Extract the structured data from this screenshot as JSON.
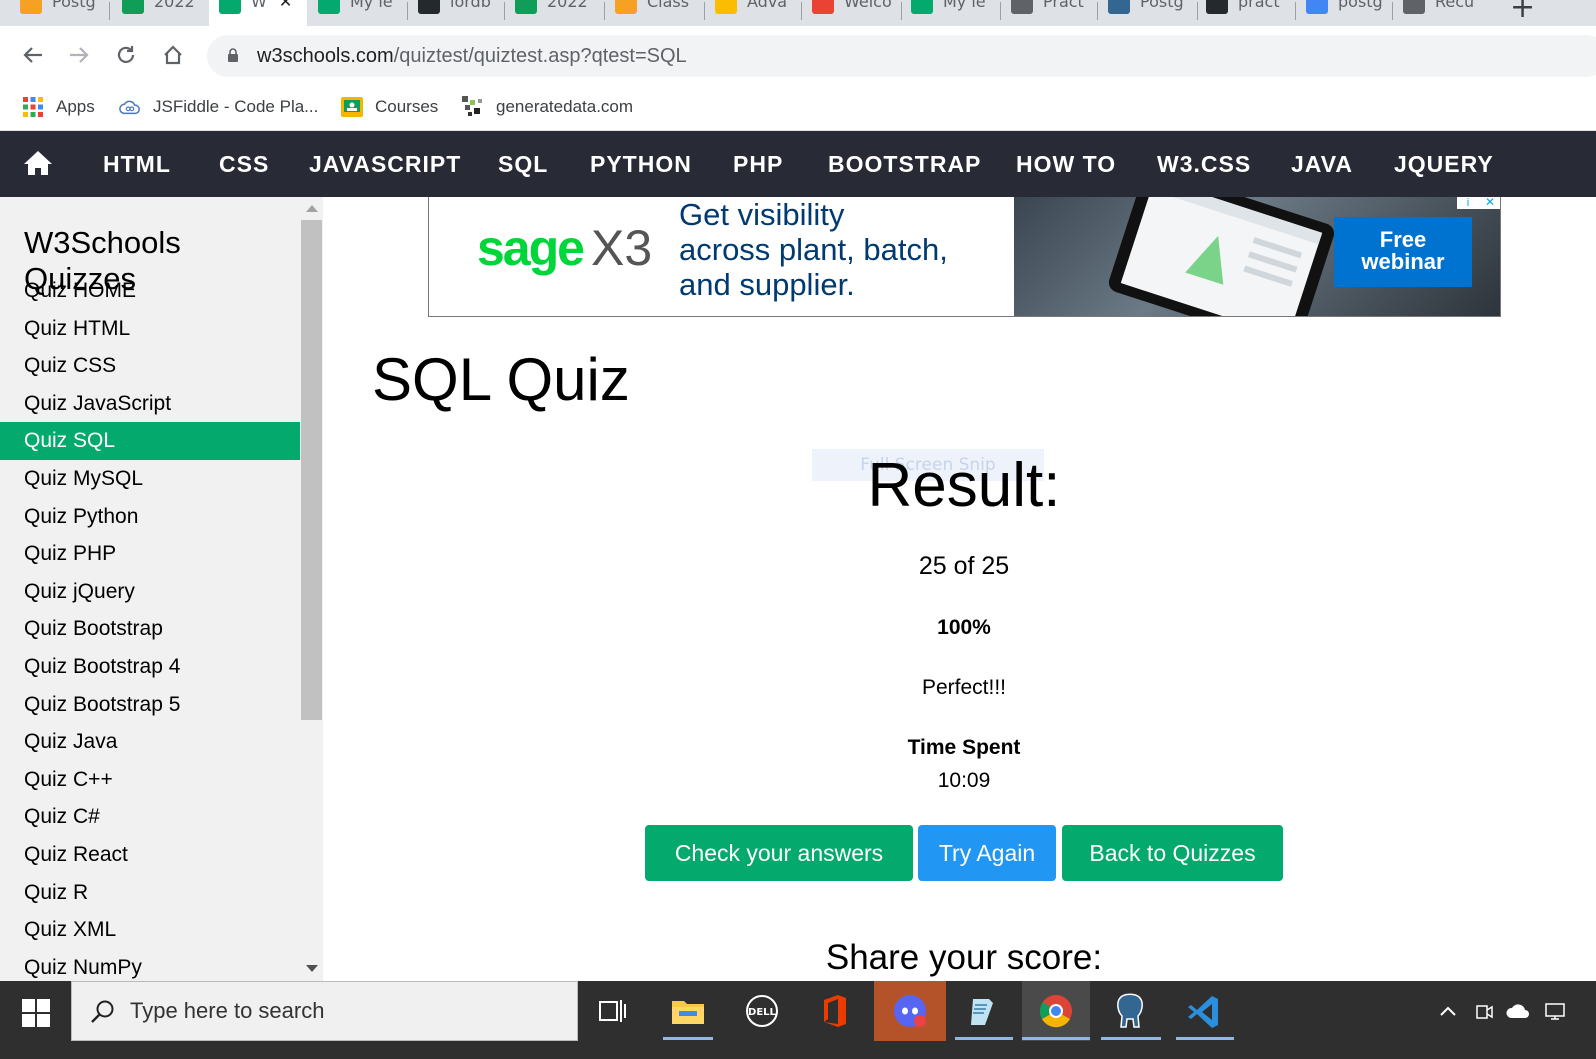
{
  "browser": {
    "tabs": [
      {
        "label": "Postg",
        "icon": "postgres-classroom-icon",
        "color": "#f4a124"
      },
      {
        "label": "2022",
        "icon": "sheets-icon",
        "color": "#0f9d58"
      },
      {
        "label": "W",
        "icon": "w3schools-icon",
        "color": "#04aa6d",
        "active": true,
        "close": "✕"
      },
      {
        "label": "My le",
        "icon": "w3schools-icon",
        "color": "#04aa6d"
      },
      {
        "label": "lordb",
        "icon": "github-icon",
        "color": "#24292e"
      },
      {
        "label": "2022",
        "icon": "sheets-icon",
        "color": "#0f9d58"
      },
      {
        "label": "Class",
        "icon": "classroom-icon",
        "color": "#f4a124"
      },
      {
        "label": "Adva",
        "icon": "drive-icon",
        "color": "#fbbc04"
      },
      {
        "label": "Welco",
        "icon": "gmail-icon",
        "color": "#ea4335"
      },
      {
        "label": "My le",
        "icon": "w3schools-icon",
        "color": "#04aa6d"
      },
      {
        "label": "Pract",
        "icon": "globe-icon",
        "color": "#5f6368"
      },
      {
        "label": "Postg",
        "icon": "postgres-icon",
        "color": "#336791"
      },
      {
        "label": "pract",
        "icon": "github-icon",
        "color": "#24292e"
      },
      {
        "label": "postg",
        "icon": "google-icon",
        "color": "#4285f4"
      },
      {
        "label": "Recu",
        "icon": "globe-icon",
        "color": "#5f6368"
      }
    ],
    "new_tab": "+",
    "url_host": "w3schools.com",
    "url_path": "/quiztest/quiztest.asp?qtest=SQL",
    "bookmarks": [
      {
        "label": "Apps",
        "icon": "apps-grid-icon"
      },
      {
        "label": "JSFiddle - Code Pla...",
        "icon": "jsfiddle-cloud-icon"
      },
      {
        "label": "Courses",
        "icon": "classroom-icon"
      },
      {
        "label": "generatedata.com",
        "icon": "generatedata-icon"
      }
    ]
  },
  "topnav": {
    "items": [
      "HTML",
      "CSS",
      "JAVASCRIPT",
      "SQL",
      "PYTHON",
      "PHP",
      "BOOTSTRAP",
      "HOW TO",
      "W3.CSS",
      "JAVA",
      "JQUERY"
    ]
  },
  "sidebar": {
    "title": "W3Schools Quizzes",
    "items": [
      "Quiz HOME",
      "Quiz HTML",
      "Quiz CSS",
      "Quiz JavaScript",
      "Quiz SQL",
      "Quiz MySQL",
      "Quiz Python",
      "Quiz PHP",
      "Quiz jQuery",
      "Quiz Bootstrap",
      "Quiz Bootstrap 4",
      "Quiz Bootstrap 5",
      "Quiz Java",
      "Quiz C++",
      "Quiz C#",
      "Quiz React",
      "Quiz R",
      "Quiz XML",
      "Quiz NumPy"
    ],
    "active_index": 4
  },
  "ad": {
    "brand": "sage",
    "model": "X3",
    "line1": "Get visibility",
    "line2": "across plant, batch,",
    "line3": "and supplier.",
    "cta_line1": "Free",
    "cta_line2": "webinar",
    "close": "✕",
    "info": "i"
  },
  "main": {
    "title": "SQL Quiz",
    "overlay_ghost": "Full Screen Snip",
    "result_title": "Result:",
    "score": "25 of 25",
    "percent": "100%",
    "remark": "Perfect!!!",
    "time_label": "Time Spent",
    "time_value": "10:09",
    "buttons": {
      "check": "Check your answers",
      "retry": "Try Again",
      "back": "Back to Quizzes"
    },
    "share": "Share your score:"
  },
  "taskbar": {
    "search_placeholder": "Type here to search"
  },
  "colors": {
    "w3_green": "#04aa6d",
    "try_again_blue": "#2196f3",
    "nav_dark": "#282a35"
  }
}
